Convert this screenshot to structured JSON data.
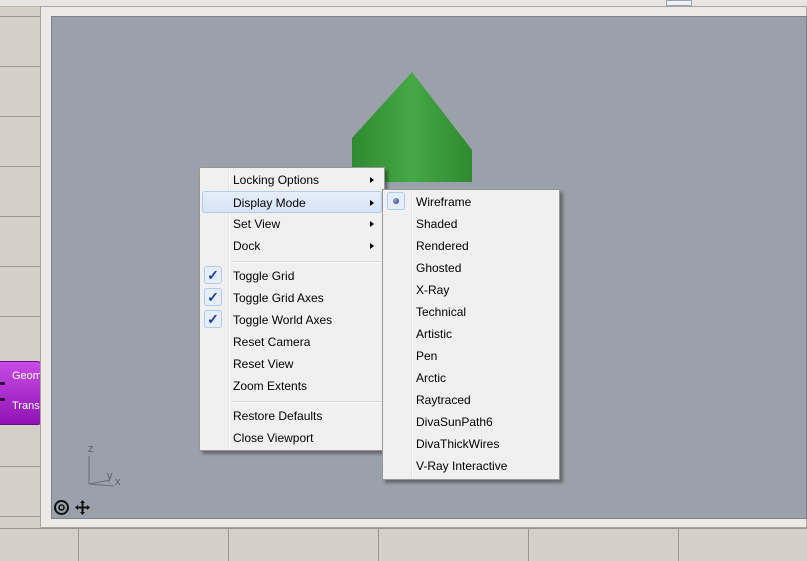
{
  "context_menu": {
    "items": [
      {
        "label": "Locking Options",
        "submenu": true
      },
      {
        "label": "Display Mode",
        "submenu": true,
        "highlighted": true
      },
      {
        "label": "Set View",
        "submenu": true
      },
      {
        "label": "Dock",
        "submenu": true
      },
      {
        "label": "Toggle Grid",
        "checked": true
      },
      {
        "label": "Toggle Grid Axes",
        "checked": true
      },
      {
        "label": "Toggle World Axes",
        "checked": true
      },
      {
        "label": "Reset Camera"
      },
      {
        "label": "Reset View"
      },
      {
        "label": "Zoom Extents"
      },
      {
        "label": "Restore Defaults"
      },
      {
        "label": "Close Viewport"
      }
    ]
  },
  "display_mode_menu": {
    "selected": "Wireframe",
    "items": [
      {
        "label": "Wireframe"
      },
      {
        "label": "Shaded"
      },
      {
        "label": "Rendered"
      },
      {
        "label": "Ghosted"
      },
      {
        "label": "X-Ray"
      },
      {
        "label": "Technical"
      },
      {
        "label": "Artistic"
      },
      {
        "label": "Pen"
      },
      {
        "label": "Arctic"
      },
      {
        "label": "Raytraced"
      },
      {
        "label": "DivaSunPath6"
      },
      {
        "label": "DivaThickWires"
      },
      {
        "label": "V-Ray Interactive"
      }
    ]
  },
  "canvas_component": {
    "labels": [
      "Geom",
      "Trans"
    ],
    "color": "#a82fd0"
  },
  "viewport": {
    "axes": {
      "z": "z",
      "y": "y",
      "x": "x"
    },
    "background_color": "#9aa1aa",
    "object_color": "#3f9f3f",
    "icons": [
      "world-axes-icon",
      "pan-move-icon"
    ]
  }
}
